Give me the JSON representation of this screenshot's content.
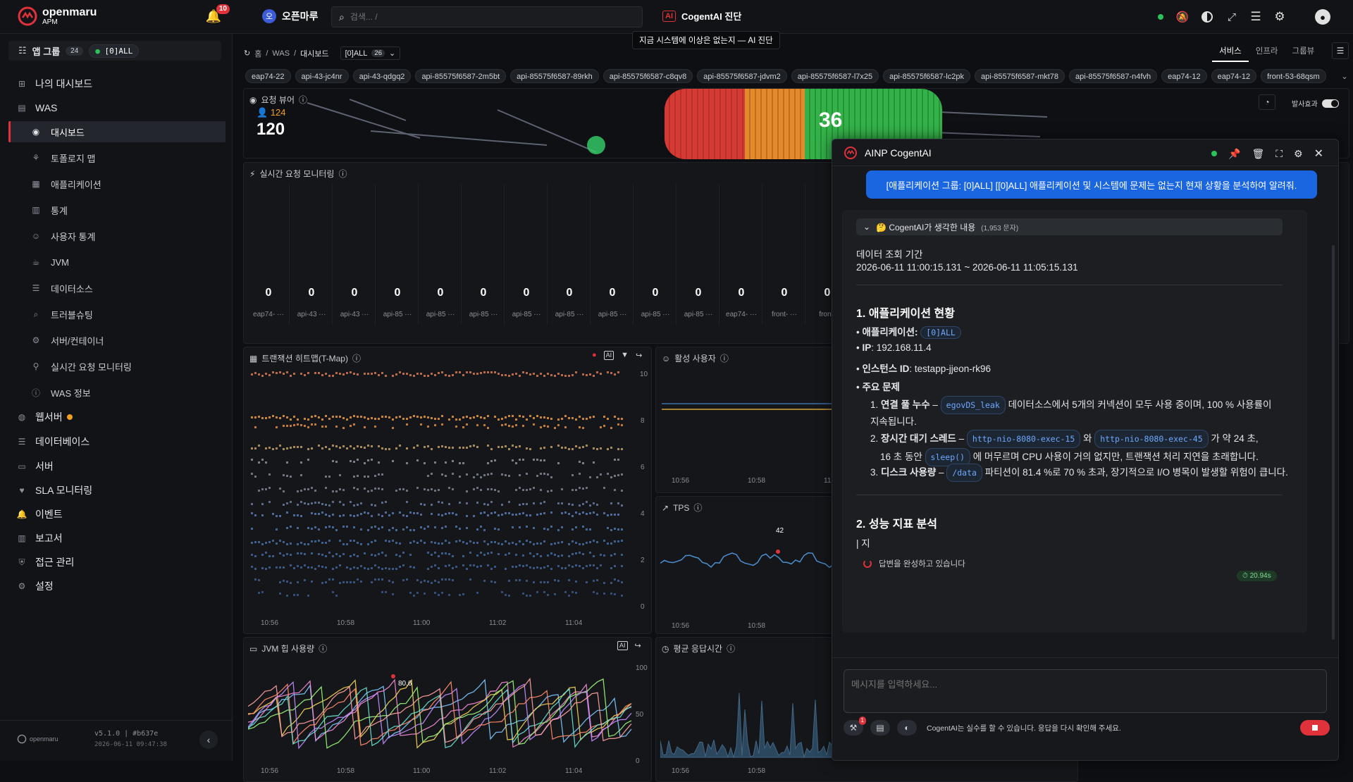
{
  "topbar": {
    "logo_text": "openmaru",
    "logo_sub": "APM",
    "notif_count": "10",
    "org_name": "오픈마루",
    "search_placeholder": "검색... /",
    "ai_label": "CogentAI 진단",
    "ai_tooltip": "지금 시스템에 이상은 없는지 — AI 진단"
  },
  "sidebar": {
    "app_group_label": "앱 그룹",
    "app_group_count": "24",
    "app_group_selected": "[0]ALL",
    "items": [
      {
        "label": "나의 대시보드",
        "icon": "grid-icon"
      },
      {
        "label": "WAS",
        "icon": "server-stack-icon"
      },
      {
        "label": "웹서버",
        "icon": "globe-icon"
      },
      {
        "label": "데이터베이스",
        "icon": "database-icon"
      },
      {
        "label": "서버",
        "icon": "monitor-icon"
      },
      {
        "label": "SLA 모니터링",
        "icon": "heartbeat-icon"
      },
      {
        "label": "이벤트",
        "icon": "bell-icon"
      },
      {
        "label": "보고서",
        "icon": "chart-icon"
      },
      {
        "label": "접근 관리",
        "icon": "shield-icon"
      },
      {
        "label": "설정",
        "icon": "gears-icon"
      }
    ],
    "was_subitems": [
      {
        "label": "대시보드",
        "icon": "dashboard-icon"
      },
      {
        "label": "토폴로지 맵",
        "icon": "topology-icon"
      },
      {
        "label": "애플리케이션",
        "icon": "app-chart-icon"
      },
      {
        "label": "통계",
        "icon": "stats-icon"
      },
      {
        "label": "사용자 통계",
        "icon": "users-icon"
      },
      {
        "label": "JVM",
        "icon": "jvm-icon"
      },
      {
        "label": "데이터소스",
        "icon": "datasource-icon"
      },
      {
        "label": "트러블슈팅",
        "icon": "search-icon"
      },
      {
        "label": "서버/컨테이너",
        "icon": "container-icon"
      },
      {
        "label": "실시간 요청 모니터링",
        "icon": "realtime-icon"
      },
      {
        "label": "WAS 정보",
        "icon": "info-icon"
      }
    ],
    "version": "v5.1.0 | #b637e",
    "build_time": "2026-06-11 09:47:38"
  },
  "breadcrumb": {
    "home": "홈",
    "was": "WAS",
    "current": "대시보드",
    "group": "[0]ALL",
    "group_count": "26"
  },
  "view_tabs": [
    "서비스",
    "인프라",
    "그룹뷰"
  ],
  "instance_chips": [
    "eap74-22",
    "api-43-jc4nr",
    "api-43-qdgq2",
    "api-85575f6587-2m5bt",
    "api-85575f6587-89rkh",
    "api-85575f6587-c8qv8",
    "api-85575f6587-jdvm2",
    "api-85575f6587-l7x25",
    "api-85575f6587-lc2pk",
    "api-85575f6587-mkt78",
    "api-85575f6587-n4fvh",
    "eap74-12",
    "eap74-12",
    "front-53-68qsm"
  ],
  "request_viewer": {
    "title": "요청 뷰어",
    "users": "124",
    "total": "120",
    "big_number": "36",
    "effect_label": "발사효과"
  },
  "realtime": {
    "title": "실시간 요청 모니터링",
    "values": [
      "0",
      "0",
      "0",
      "0",
      "0",
      "0",
      "0",
      "0",
      "0",
      "0",
      "0",
      "0",
      "0",
      "0"
    ],
    "labels": [
      "eap74- ···",
      "api-43 ···",
      "api-43 ···",
      "api-85 ···",
      "api-85 ···",
      "api-85 ···",
      "api-85 ···",
      "api-85 ···",
      "api-85 ···",
      "api-85 ···",
      "api-85 ···",
      "eap74- ···",
      "front- ···",
      "front-"
    ]
  },
  "tmap": {
    "title": "트랜잭션 히트맵(T-Map)",
    "y_ticks": [
      "10",
      "8",
      "6",
      "4",
      "2",
      "0"
    ],
    "x_ticks": [
      "10:56",
      "10:58",
      "11:00",
      "11:02",
      "11:04"
    ]
  },
  "active_users": {
    "title": "활성 사용자",
    "x_ticks": [
      "10:56",
      "10:58",
      "11:"
    ]
  },
  "tps": {
    "title": "TPS",
    "peak": "42",
    "x_ticks": [
      "10:56",
      "10:58"
    ]
  },
  "jvm_heap": {
    "title": "JVM 힙 사용량",
    "peak": "80.6",
    "y_ticks": [
      "100",
      "50",
      "0"
    ],
    "x_ticks": [
      "10:56",
      "10:58",
      "11:00",
      "11:02",
      "11:04"
    ]
  },
  "avg_resp": {
    "title": "평균 응답시간",
    "x_ticks": [
      "10:56",
      "10:58"
    ]
  },
  "chat": {
    "title": "AINP CogentAI",
    "user_message": "[애플리케이션 그룹: [0]ALL] [[0]ALL] 애플리케이션 및 시스템에 문제는 없는지 현재 상황을 분석하여 알려줘.",
    "thinking_label": "🤔 CogentAI가 생각한 내용",
    "thinking_count": "(1,953 문자)",
    "period_title": "데이터 조회 기간",
    "period_value": "2026-06-11 11:00:15.131 ~ 2026-06-11 11:05:15.131",
    "h1": "1. 애플리케이션 현황",
    "app_label": "애플리케이션:",
    "app_value": "[0]ALL",
    "ip_label": "IP",
    "ip_value": ": 192.168.11.4",
    "inst_label": "인스턴스 ID",
    "inst_value": ": testapp-jjeon-rk96",
    "issues_label": "주요 문제",
    "issue1_bold": "연결 풀 누수",
    "issue1_dash": " – ",
    "issue1_code": "egovDS_leak",
    "issue1_text": " 데이터소스에서 5개의 커넥션이 모두 사용 중이며, 100 % 사용률이 지속됩니다.",
    "issue2_bold": "장시간 대기 스레드",
    "issue2_dash": " – ",
    "issue2_code1": "http-nio-8080-exec-15",
    "issue2_and": " 와 ",
    "issue2_code2": "http-nio-8080-exec-45",
    "issue2_text1": " 가 약 24 초,",
    "issue2_text2": "16 초 동안 ",
    "issue2_code3": "sleep()",
    "issue2_text3": " 에 머무르며 CPU 사용이 거의 없지만, 트랜잭션 처리 지연을 초래합니다.",
    "issue3_bold": "디스크 사용량",
    "issue3_dash": " – ",
    "issue3_code": "/data",
    "issue3_text": " 파티션이 81.4 %로 70 % 초과, 장기적으로 I/O 병목이 발생할 위험이 큽니다.",
    "h2": "2. 성능 지표 분석",
    "typing": "| 지",
    "status": "답변을 완성하고 있습니다",
    "elapsed": "20.94s",
    "input_placeholder": "메시지를 입력하세요...",
    "tool_badge": "1",
    "disclaimer": "CogentAI는 실수를 할 수 있습니다. 응답을 다시 확인해 주세요."
  }
}
